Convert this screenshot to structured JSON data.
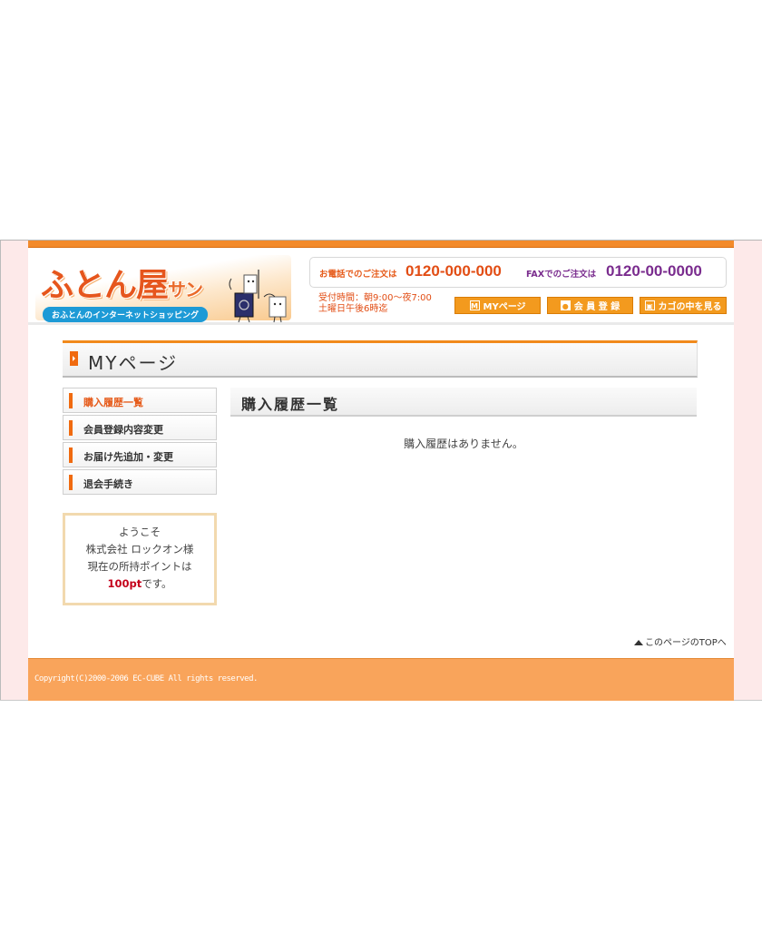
{
  "header": {
    "logo_title": "ふとん屋",
    "logo_suffix": "サン",
    "logo_sub": "おふとんのインターネットショッピング",
    "phone_label": "お電話でのご注文は",
    "phone_number": "0120-000-000",
    "fax_label": "FAXでのご注文は",
    "fax_number": "0120-00-0000",
    "hours_line1": "受付時間：朝9:00〜夜7:00",
    "hours_line2": "土曜日午後6時迄",
    "nav": [
      {
        "label": "MYページ",
        "icon": "M"
      },
      {
        "label": "会 員 登 録",
        "icon": "person"
      },
      {
        "label": "カゴの中を見る",
        "icon": "cart"
      }
    ]
  },
  "page_title": "MYページ",
  "sidebar": {
    "items": [
      {
        "label": "購入履歴一覧",
        "active": true
      },
      {
        "label": "会員登録内容変更",
        "active": false
      },
      {
        "label": "お届け先追加・変更",
        "active": false
      },
      {
        "label": "退会手続き",
        "active": false
      }
    ]
  },
  "welcome": {
    "line1": "ようこそ",
    "line2": "株式会社 ロックオン様",
    "line3": "現在の所持ポイントは",
    "points": "100pt",
    "suffix": "です。"
  },
  "main": {
    "heading": "購入履歴一覧",
    "empty_message": "購入履歴はありません。"
  },
  "to_top": "このページのTOPへ",
  "footer": {
    "copyright": "Copyright(C)2000-2006 EC-CUBE All rights reserved."
  },
  "colors": {
    "accent": "#f06a0f",
    "footer": "#f9a45b",
    "phone": "#e24d14",
    "fax": "#7a2c8e",
    "frame": "#fde9e9"
  }
}
